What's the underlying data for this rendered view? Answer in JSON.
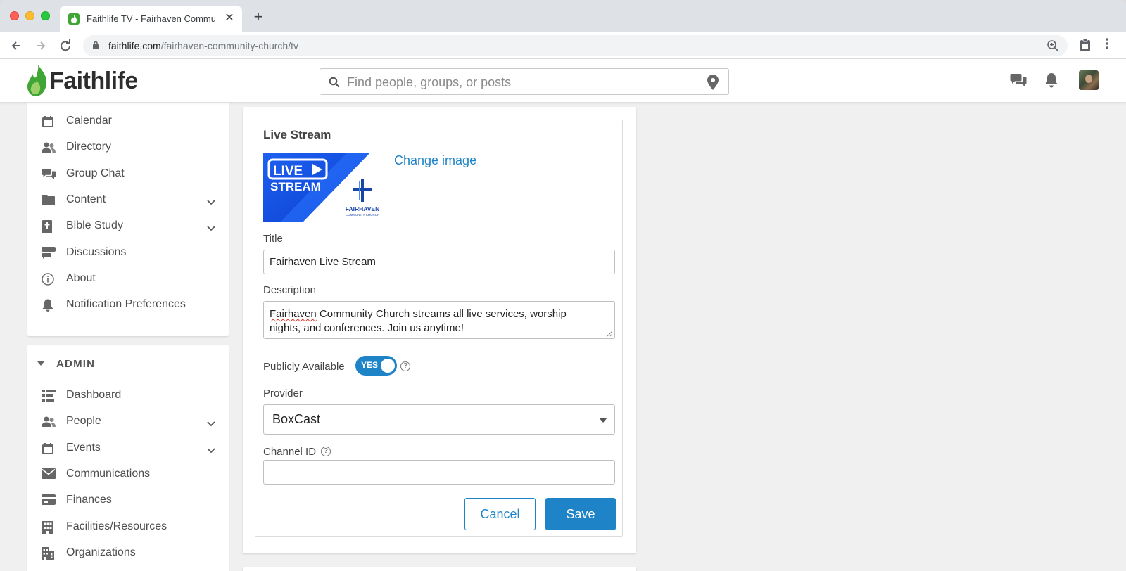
{
  "browser": {
    "tab_title": "Faithlife TV - Fairhaven Community Church",
    "url_host": "faithlife.com",
    "url_path": "/fairhaven-community-church/tv",
    "new_tab_glyph": "+",
    "close_glyph": "✕"
  },
  "header": {
    "logo_text": "Faithlife",
    "search_placeholder": "Find people, groups, or posts"
  },
  "sidebar": {
    "items": [
      {
        "label": "Calendar",
        "icon": "calendar-icon"
      },
      {
        "label": "Directory",
        "icon": "people-icon"
      },
      {
        "label": "Group Chat",
        "icon": "chat-bubbles-icon"
      },
      {
        "label": "Content",
        "icon": "folder-icon",
        "expandable": true
      },
      {
        "label": "Bible Study",
        "icon": "bible-icon",
        "expandable": true
      },
      {
        "label": "Discussions",
        "icon": "discussions-icon"
      },
      {
        "label": "About",
        "icon": "info-icon"
      },
      {
        "label": "Notification Preferences",
        "icon": "bell-icon"
      }
    ]
  },
  "admin": {
    "heading": "ADMIN",
    "items": [
      {
        "label": "Dashboard",
        "icon": "dashboard-icon"
      },
      {
        "label": "People",
        "icon": "people-icon",
        "expandable": true
      },
      {
        "label": "Events",
        "icon": "calendar-icon",
        "expandable": true
      },
      {
        "label": "Communications",
        "icon": "envelope-icon"
      },
      {
        "label": "Finances",
        "icon": "credit-card-icon"
      },
      {
        "label": "Facilities/Resources",
        "icon": "building-icon"
      },
      {
        "label": "Organizations",
        "icon": "organizations-icon"
      }
    ]
  },
  "form": {
    "section_title": "Live Stream",
    "change_image_label": "Change image",
    "image_text": {
      "live": "LIVE",
      "stream": "STREAM",
      "church_name": "FAIRHAVEN",
      "church_sub": "COMMUNITY CHURCH"
    },
    "title_label": "Title",
    "title_value": "Fairhaven Live Stream",
    "description_label": "Description",
    "description_first_word": "Fairhaven",
    "description_rest": " Community Church streams all live services, worship nights, and conferences. Join us anytime!",
    "public_label": "Publicly Available",
    "public_toggle_text": "YES",
    "public_enabled": true,
    "provider_label": "Provider",
    "provider_value": "BoxCast",
    "channel_label": "Channel ID",
    "channel_value": "",
    "cancel_label": "Cancel",
    "save_label": "Save",
    "help_glyph": "?"
  },
  "colors": {
    "accent": "#1f84c7",
    "brand_green": "#3fa535",
    "image_blue": "#1457e8"
  }
}
